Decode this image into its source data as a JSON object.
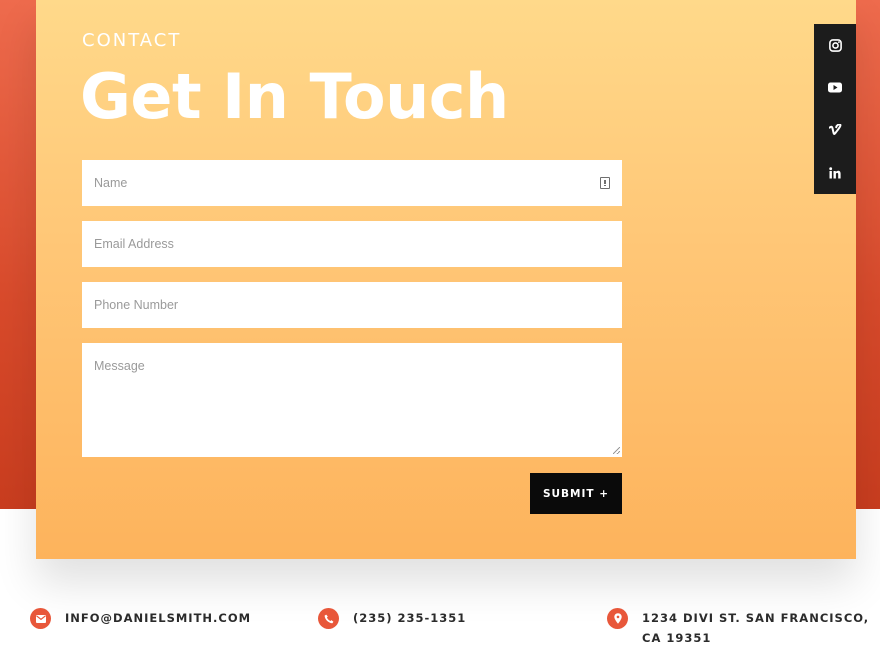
{
  "section": {
    "eyebrow": "CONTACT",
    "headline": "Get In Touch"
  },
  "form": {
    "name_placeholder": "Name",
    "email_placeholder": "Email Address",
    "phone_placeholder": "Phone Number",
    "message_placeholder": "Message",
    "submit_label": "SUBMIT +"
  },
  "social": {
    "items": [
      "instagram-icon",
      "youtube-icon",
      "vimeo-icon",
      "linkedin-icon"
    ]
  },
  "contact_info": {
    "email": "INFO@DANIELSMITH.COM",
    "phone": "(235) 235-1351",
    "address_line1": "1234 DIVI ST. SAN FRANCISCO,",
    "address_line2": "CA 19351"
  },
  "colors": {
    "band": "#d84a2b",
    "card_top": "#ffd98a",
    "card_bottom": "#fdb35c",
    "accent": "#e8573a",
    "dark": "#0a0a0a"
  }
}
